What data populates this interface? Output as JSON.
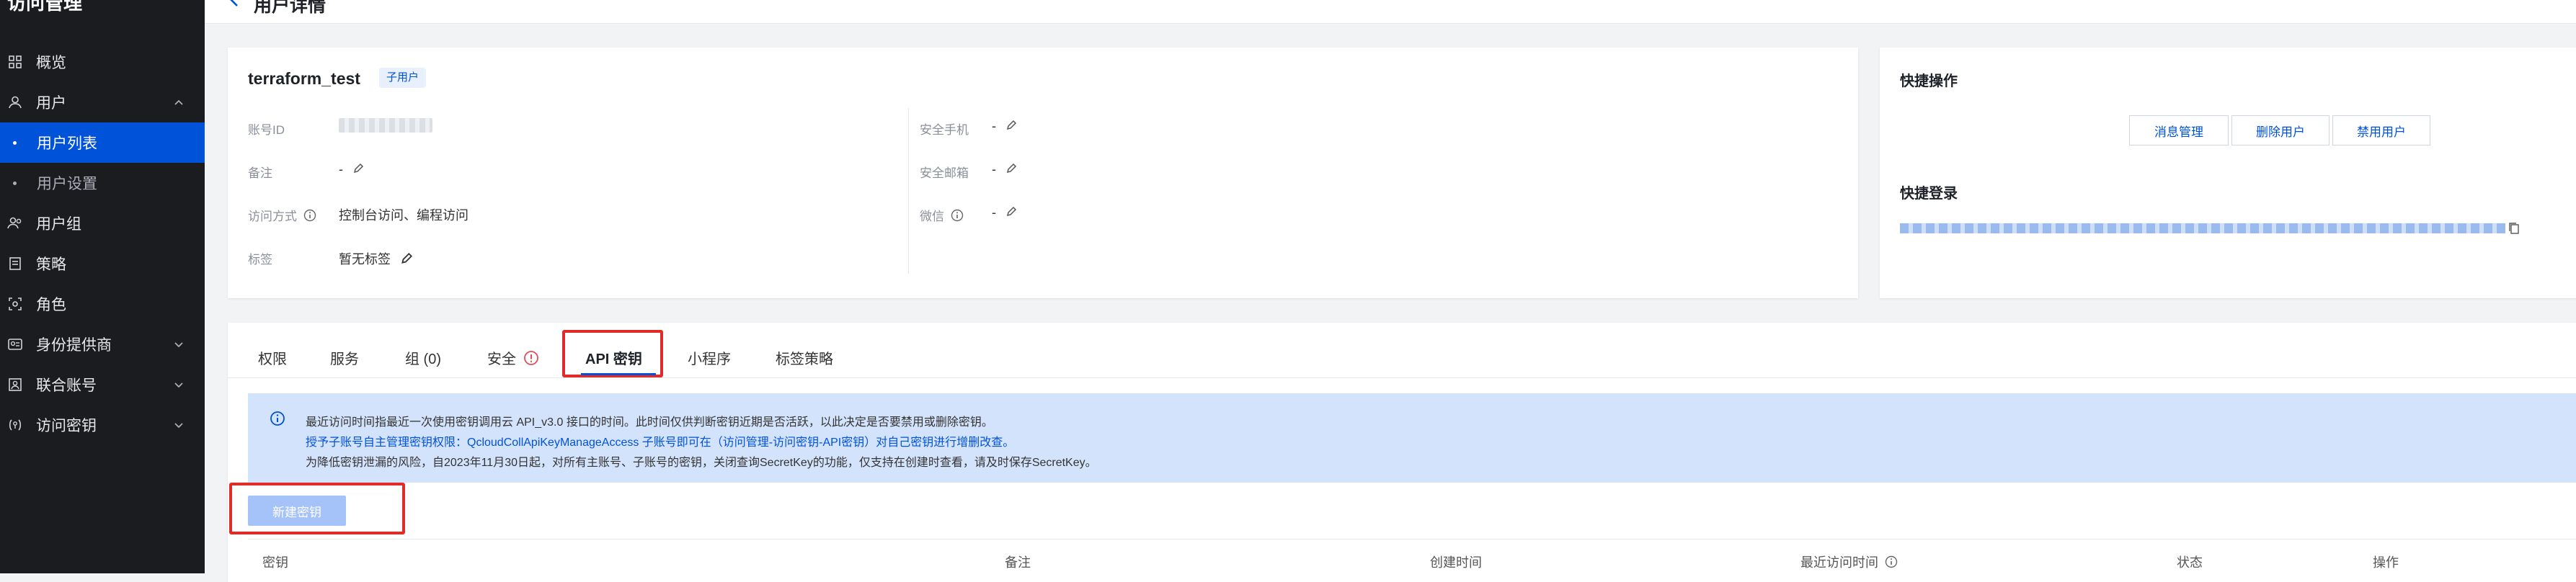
{
  "sidebar": {
    "title": "访问管理",
    "items": [
      {
        "label": "概览",
        "icon": "grid-icon"
      },
      {
        "label": "用户",
        "icon": "user-icon"
      },
      {
        "label": "用户列表"
      },
      {
        "label": "用户设置"
      },
      {
        "label": "用户组",
        "icon": "user-group-icon"
      },
      {
        "label": "策略",
        "icon": "policy-icon"
      },
      {
        "label": "角色",
        "icon": "role-icon"
      },
      {
        "label": "身份提供商",
        "icon": "identity-provider-icon"
      },
      {
        "label": "联合账号",
        "icon": "federated-account-icon"
      },
      {
        "label": "访问密钥",
        "icon": "access-key-icon"
      }
    ]
  },
  "header": {
    "title": "用户详情"
  },
  "user": {
    "name": "terraform_test",
    "badge": "子用户",
    "fields": {
      "account_id_label": "账号ID",
      "remark_label": "备注",
      "remark_value": "-",
      "access_label": "访问方式",
      "access_value": "控制台访问、编程访问",
      "tags_label": "标签",
      "tags_value": "暂无标签",
      "phone_label": "安全手机",
      "phone_value": "-",
      "email_label": "安全邮箱",
      "email_value": "-",
      "wechat_label": "微信",
      "wechat_value": "-"
    }
  },
  "quick_actions": {
    "title": "快捷操作",
    "buttons": [
      "消息管理",
      "删除用户",
      "禁用用户"
    ],
    "login_title": "快捷登录"
  },
  "tabs": {
    "items": [
      "权限",
      "服务",
      "组 (0)",
      "安全",
      "API 密钥",
      "小程序",
      "标签策略"
    ],
    "active": "API 密钥"
  },
  "notice": {
    "line1": "最近访问时间指最近一次使用密钥调用云 API_v3.0 接口的时间。此时间仅供判断密钥近期是否活跃，以此决定是否要禁用或删除密钥。",
    "line2": "授予子账号自主管理密钥权限：QcloudCollApiKeyManageAccess 子账号即可在（访问管理-访问密钥-API密钥）对自己密钥进行增删改查。",
    "line3": "为降低密钥泄漏的风险，自2023年11月30日起，对所有主账号、子账号的密钥，关闭查询SecretKey的功能，仅支持在创建时查看，请及时保存SecretKey。"
  },
  "new_key_button": "新建密钥",
  "table": {
    "columns": [
      "密钥",
      "备注",
      "创建时间",
      "最近访问时间",
      "状态",
      "操作"
    ]
  },
  "colors": {
    "primary": "#0052d9",
    "sidebar_bg": "#1b1c1f",
    "highlight_red": "#e12b2b",
    "notice_bg": "#d4e3fc",
    "warning_red": "#e34d59"
  }
}
